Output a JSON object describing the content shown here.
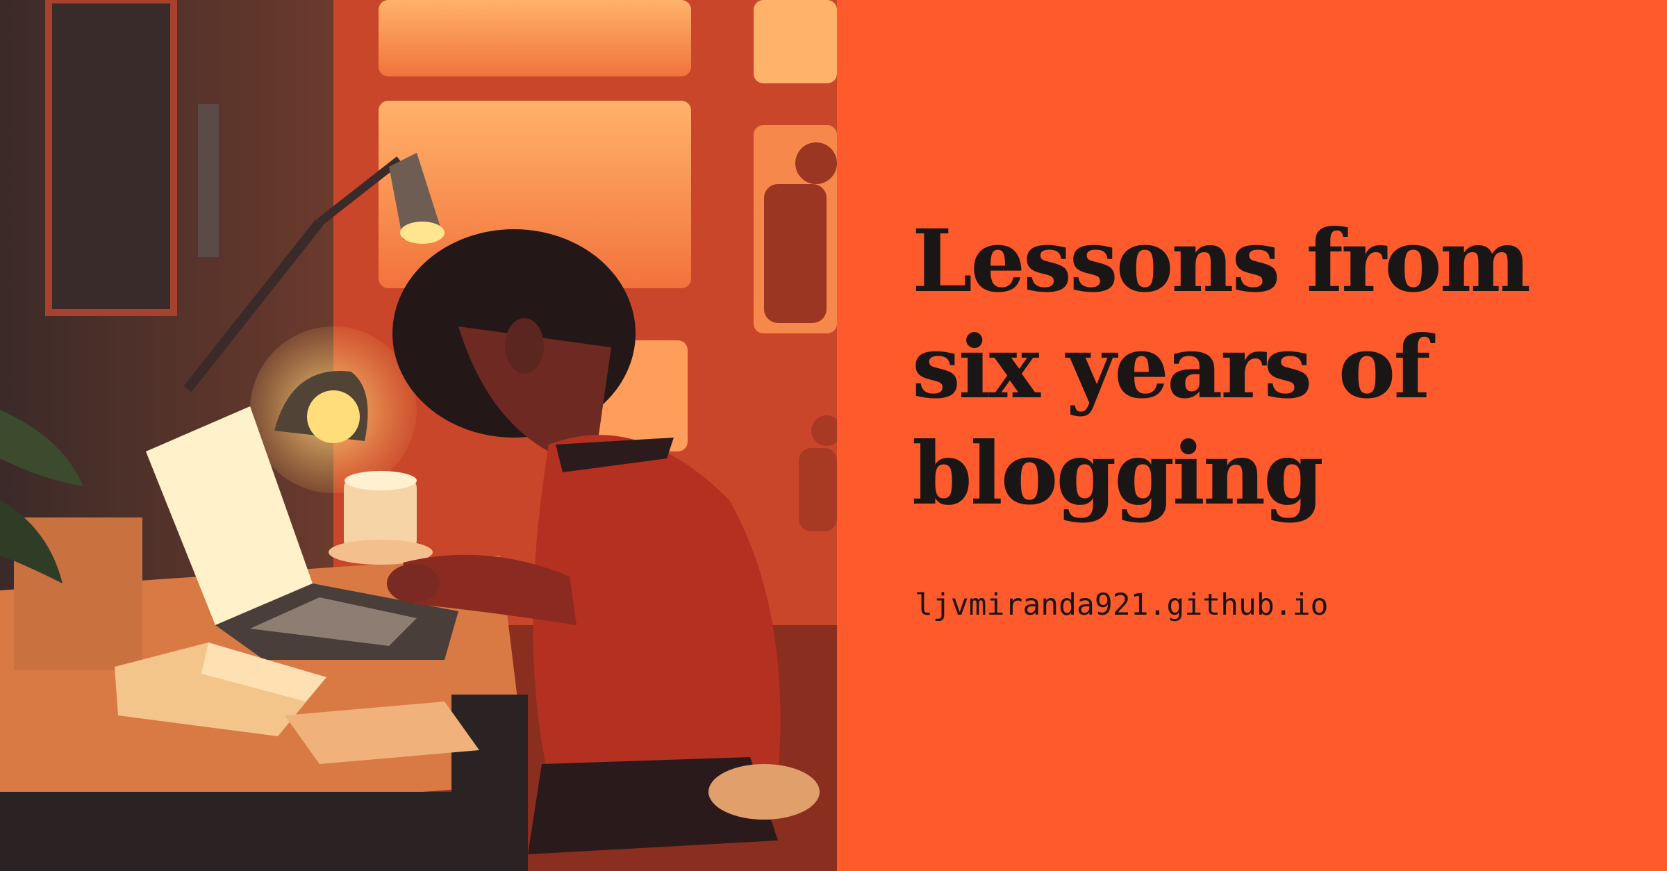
{
  "card": {
    "title": "Lessons from six years of blogging",
    "site": "ljvmiranda921.github.io",
    "colors": {
      "background": "#ff5a2c",
      "text": "#1b1616"
    }
  },
  "illustration": {
    "icon": "boy-typing-on-laptop-at-desk-illustration"
  }
}
